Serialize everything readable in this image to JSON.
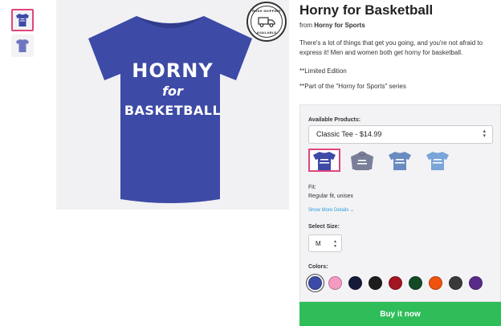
{
  "product": {
    "title": "Horny for Basketball",
    "from_prefix": "from",
    "store": "Horny for Sports",
    "description": [
      "There's a lot of things that get you going, and you're not afraid to express it! Men and women both get horny for basketball.",
      "**Limited Edition",
      "**Part of the \"Horny for Sports\" series"
    ],
    "design_text": {
      "line1": "HORNY",
      "line2": "for",
      "line3": "BASKETBALL"
    }
  },
  "badge": {
    "top": "RUSH SHIPPING",
    "bottom": "AVAILABLE"
  },
  "options": {
    "products_label": "Available Products:",
    "selected_product": "Classic Tee - $14.99",
    "product_thumbs": [
      {
        "name": "classic-tee",
        "color": "#3d4aa6"
      },
      {
        "name": "hoodie",
        "color": "#7a7f99"
      },
      {
        "name": "tee-heather",
        "color": "#6a8bc0"
      },
      {
        "name": "tee-light",
        "color": "#79a5d8"
      }
    ],
    "fit_label": "Fit:",
    "fit_value": "Regular fit, unisex",
    "show_more": "Show More Details",
    "size_label": "Select Size:",
    "size_value": "M",
    "colors_label": "Colors:",
    "colors": [
      "#3d4aa6",
      "#f59ac1",
      "#15193a",
      "#1d1d1d",
      "#a31520",
      "#134a26",
      "#f0520f",
      "#3a3a3a",
      "#5a2a8a"
    ]
  },
  "buy_label": "Buy it now",
  "colors_ui": {
    "accent": "#e0457b",
    "buy": "#2ebd59",
    "link": "#2a9fd6",
    "shirt": "#3d4aa6"
  }
}
